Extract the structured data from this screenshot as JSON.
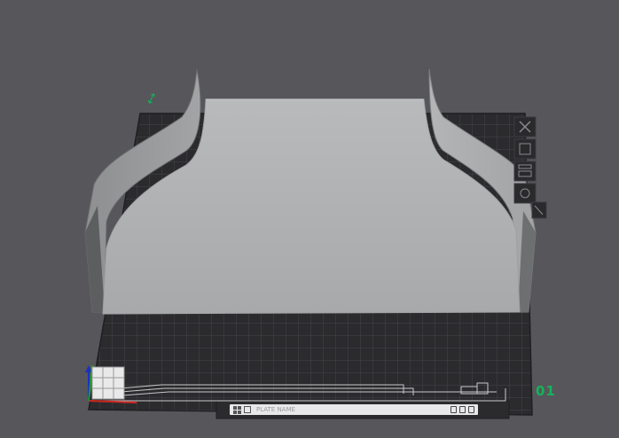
{
  "plate": {
    "index_label": "01",
    "name_placeholder": "PLATE NAME",
    "toolbar_icons": [
      "arrange-icon",
      "orient-icon",
      "lock-icon",
      "settings-icon"
    ],
    "bottom_bar_icons": [
      "grid-icon",
      "select-icon",
      "delete-icon",
      "copy-icon",
      "trash-icon"
    ]
  },
  "colors": {
    "background": "#57565b",
    "bed": "#2b2b2e",
    "bed_grid": "#48484c",
    "model": "#b3b4b5",
    "accent_green": "#14b35a",
    "axis_x": "#d0281f",
    "axis_y": "#1a9a2a",
    "axis_z": "#1f2fbf"
  }
}
